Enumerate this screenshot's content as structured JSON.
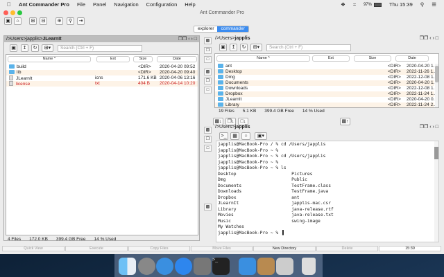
{
  "menubar": {
    "app": "Ant Commander Pro",
    "items": [
      "File",
      "Panel",
      "Navigation",
      "Configuration",
      "Help"
    ],
    "battery": "97%",
    "clock": "Thu 15:39"
  },
  "window": {
    "title": "Ant Commander Pro"
  },
  "tabs": [
    {
      "label": "explorer",
      "active": false
    },
    {
      "label": "commander",
      "active": true
    }
  ],
  "search_placeholder": "Search (Ctrl + F)",
  "columns": {
    "name": "Name ^",
    "ext": "Ext",
    "size": "Size",
    "date": "Date"
  },
  "left": {
    "path_prefix": "/>Users>japplis>",
    "path_bold": "JLearnIt",
    "rows": [
      {
        "name": "build",
        "ext": "",
        "size": "<DIR>",
        "date": "2020-04-20 09:52",
        "type": "folder"
      },
      {
        "name": "lib",
        "ext": "",
        "size": "<DIR>",
        "date": "2020-04-20 09:40",
        "type": "folder"
      },
      {
        "name": "JLearnIt",
        "ext": "icns",
        "size": "171.6 KB",
        "date": "2020-04-06 13:16",
        "type": "file"
      },
      {
        "name": "license",
        "ext": "txt",
        "size": "404 B",
        "date": "2020-04-14 10:20",
        "type": "file",
        "highlight": true
      }
    ],
    "status": {
      "files": "4 Files",
      "size": "172.0 KB",
      "free": "399.4 GB Free",
      "used": "14 % Used"
    }
  },
  "right_top": {
    "path_prefix": "/>Users>",
    "path_bold": "japplis",
    "rows": [
      {
        "name": "ant",
        "size": "<DIR>",
        "date": "2020-04-20 1..."
      },
      {
        "name": "Desktop",
        "size": "<DIR>",
        "date": "2022-11-26 1..."
      },
      {
        "name": "Dmg",
        "size": "<DIR>",
        "date": "2022-12-08 1..."
      },
      {
        "name": "Documents",
        "size": "<DIR>",
        "date": "2020-04-20 1..."
      },
      {
        "name": "Downloads",
        "size": "<DIR>",
        "date": "2022-12-08 1..."
      },
      {
        "name": "Dropbox",
        "size": "<DIR>",
        "date": "2022-11-24 1..."
      },
      {
        "name": "JLearnIt",
        "size": "<DIR>",
        "date": "2020-04-20 0..."
      },
      {
        "name": "Library",
        "size": "<DIR>",
        "date": "2022-11-24 2..."
      }
    ],
    "status": {
      "files": "19 Files",
      "size": "5.1 KB",
      "free": "399.4 GB Free",
      "used": "14 % Used"
    }
  },
  "terminal": {
    "path_prefix": "/>Users>",
    "path_bold": "japplis",
    "text": "japplis@MacBook-Pro / % cd /Users/japplis\njapplis@MacBook-Pro ~ %\njapplis@MacBook-Pro ~ % cd /Users/japplis\njapplis@MacBook-Pro ~ %\njapplis@MacBook-Pro ~ % ls\nDesktop                     Pictures\nDmg                         Public\nDocuments                   TestFrame.class\nDownloads                   TestFrame.java\nDropbox                     ant\nJLearnIt                    japplis-mac.csr\nLibrary                     java-release.rtf\nMovies                      java-release.txt\nMusic                       swing-image\nMy Watches\njapplis@MacBook-Pro ~ % ▐"
  },
  "function_keys": [
    "Quick View",
    "Execute",
    "Copy Files",
    "Move Files",
    "New Directory",
    "Delete",
    "15:39"
  ],
  "colors": {
    "accent": "#3b8cf0",
    "highlight_text": "#cc2020",
    "folder": "#5bb3ea"
  }
}
